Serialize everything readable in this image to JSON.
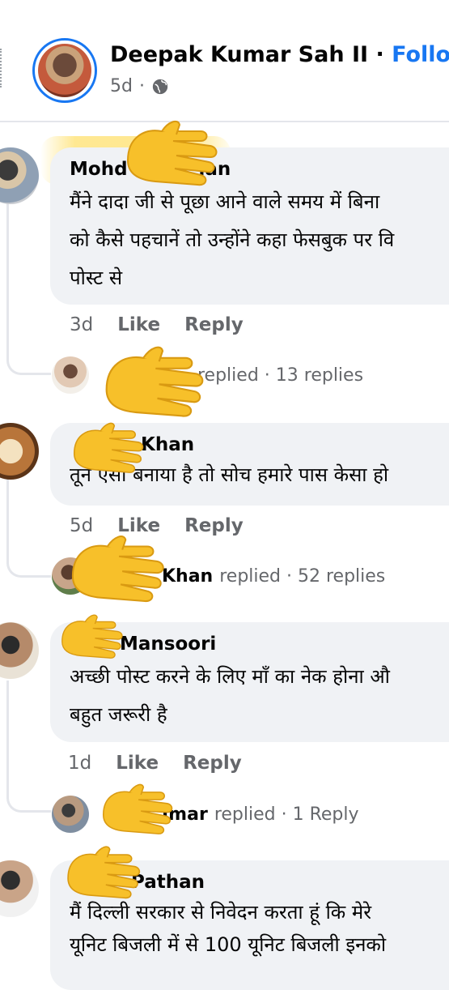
{
  "post": {
    "author": "Deepak Kumar Sah II",
    "separator": "·",
    "follow_label": "Follow",
    "time": "5d",
    "meta_dot": "·",
    "privacy_icon": "globe-icon"
  },
  "comments": [
    {
      "author": "Mohd",
      "author_tail": "ian",
      "text": "मैंने दादा जी से पूछा आने वाले समय में बिना\nको कैसे पहचानें तो उन्होंने कहा फेसबुक पर वि\nपोस्ट से",
      "time": "3d",
      "like_label": "Like",
      "reply_label": "Reply",
      "reply_summary": {
        "name": "",
        "text": "replied · 13 replies"
      }
    },
    {
      "author": "Khan",
      "text": "तून एसा बनाया है तो सोच हमारे पास केसा हो",
      "time": "5d",
      "like_label": "Like",
      "reply_label": "Reply",
      "reply_summary": {
        "name": "Khan",
        "text": "replied · 52 replies"
      }
    },
    {
      "author": "Mansoori",
      "text": "अच्छी पोस्ट करने के लिए माँ का नेक होना औ\nबहुत जरूरी है",
      "time": "1d",
      "like_label": "Like",
      "reply_label": "Reply",
      "reply_summary": {
        "name": "Jmar",
        "text": "replied · 1 Reply"
      }
    },
    {
      "author": "Pathan",
      "text": "मैं दिल्ली  सरकार से निवेदन करता हूं कि मेरे\nयूनिट बिजली में से 100 यूनिट बिजली इनको"
    }
  ],
  "colors": {
    "accent": "#1877f2",
    "bubble": "#f0f2f5",
    "secondary_text": "#65676b",
    "highlight": "#ffe16e",
    "emoji_hand": "#f7c02a"
  }
}
